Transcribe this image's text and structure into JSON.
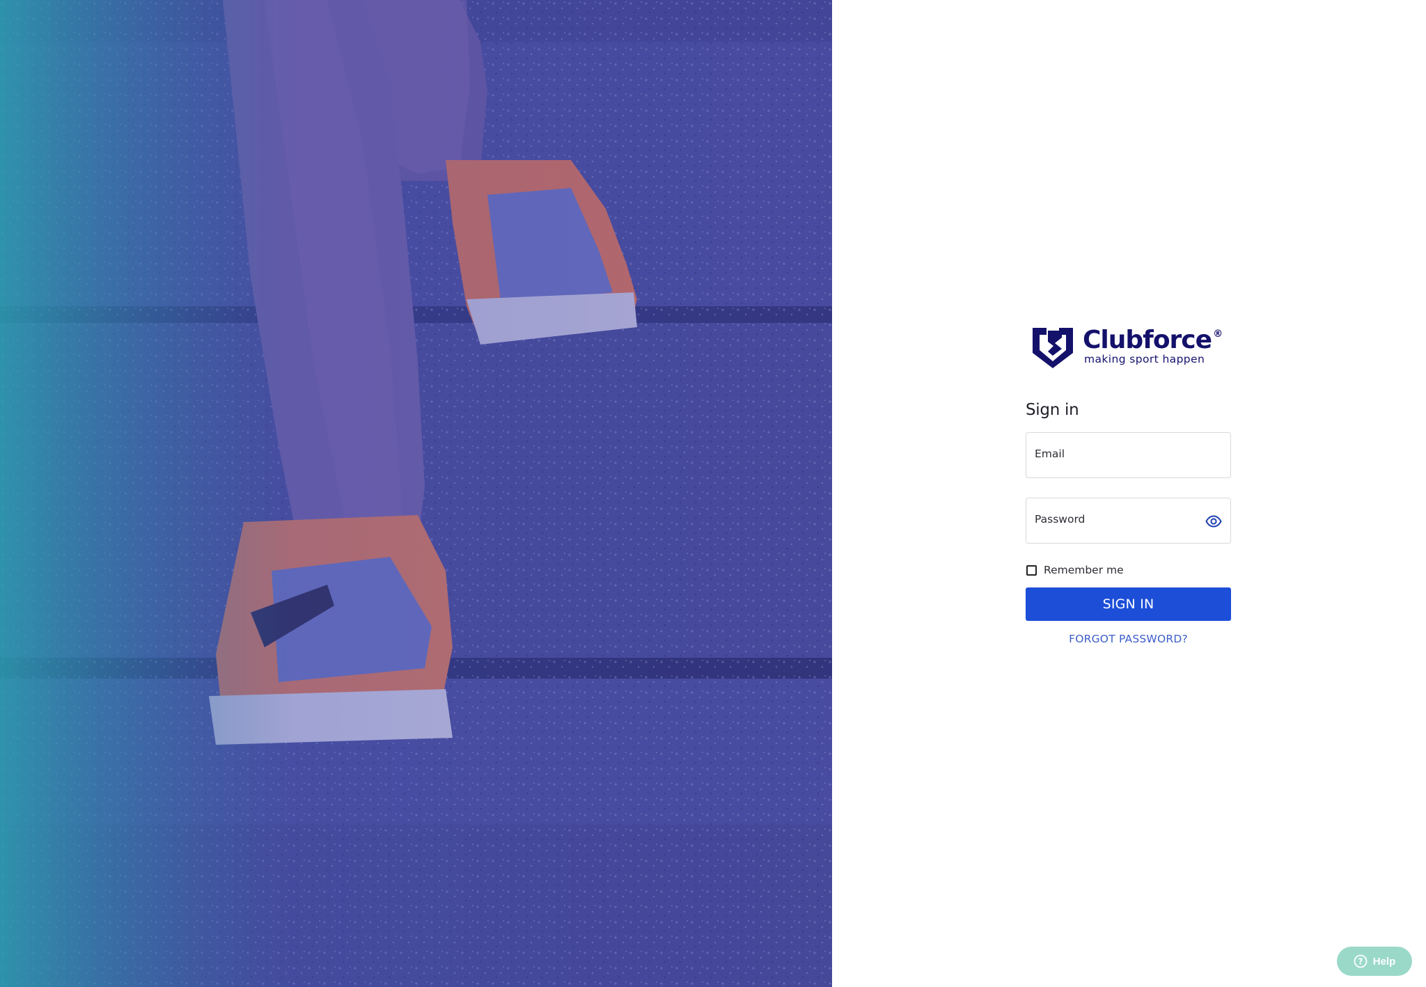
{
  "brand": {
    "name": "Clubforce",
    "registered": "®",
    "tagline": "making sport happen",
    "color": "#14116b"
  },
  "signin": {
    "title": "Sign in",
    "email_label": "Email",
    "email_value": "",
    "password_label": "Password",
    "password_value": "",
    "remember_label": "Remember me",
    "remember_checked": false,
    "submit_label": "SIGN IN",
    "forgot_label": "FORGOT PASSWORD?"
  },
  "help": {
    "label": "Help"
  },
  "hero": {
    "description_icon": "runner-stairs-photo"
  },
  "colors": {
    "primary": "#1c4ed8",
    "link": "#3c5ec9",
    "help_bg": "#9ad9c8"
  }
}
